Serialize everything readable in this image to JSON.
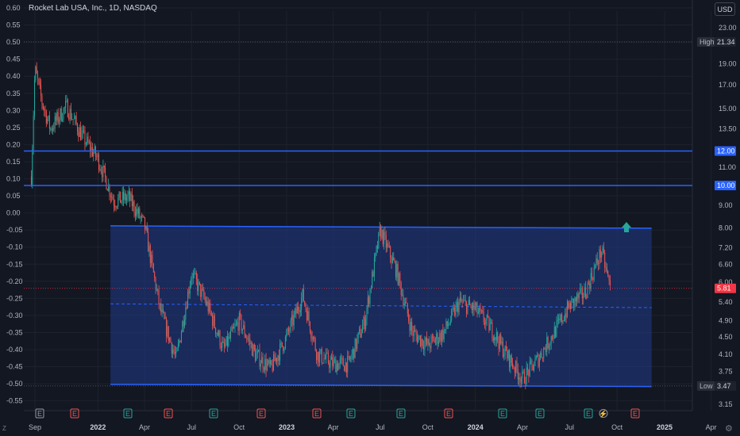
{
  "header": {
    "title": "Rocket Lab USA, Inc., 1D, NASDAQ",
    "currency": "USD"
  },
  "left_axis": {
    "ticks": [
      "0.60",
      "0.55",
      "0.50",
      "0.45",
      "0.40",
      "0.35",
      "0.30",
      "0.25",
      "0.20",
      "0.15",
      "0.10",
      "0.05",
      "0.00",
      "-0.05",
      "-0.10",
      "-0.15",
      "-0.20",
      "-0.25",
      "-0.30",
      "-0.35",
      "-0.40",
      "-0.45",
      "-0.50",
      "-0.55"
    ]
  },
  "right_axis": {
    "ticks": [
      "23.00",
      "21.34",
      "19.00",
      "17.00",
      "15.00",
      "13.50",
      "12.00",
      "11.00",
      "10.00",
      "9.00",
      "8.00",
      "7.20",
      "6.60",
      "6.00",
      "5.81",
      "5.40",
      "4.90",
      "4.50",
      "4.10",
      "3.75",
      "3.47",
      "3.15"
    ],
    "badges": {
      "high": {
        "label": "High",
        "value": "21.34"
      },
      "low": {
        "label": "Low",
        "value": "3.47"
      },
      "line_upper": "12.00",
      "line_lower": "10.00",
      "last_price": "5.81"
    }
  },
  "time_axis": {
    "labels": [
      "Sep",
      "2022",
      "Apr",
      "Jul",
      "Oct",
      "2023",
      "Apr",
      "Jul",
      "Oct",
      "2024",
      "Apr",
      "Jul",
      "Oct",
      "2025",
      "Apr"
    ]
  },
  "event_markers": [
    "E",
    "E",
    "E",
    "E",
    "E",
    "E",
    "E",
    "E",
    "E",
    "E",
    "E",
    "E",
    "E",
    "E"
  ],
  "colors": {
    "background": "#131722",
    "up": "#26a69a",
    "down": "#ef5350",
    "line": "#2962ff",
    "channel_fill": "#1f3a8a",
    "last_price": "#f23645"
  },
  "chart_data": {
    "type": "candlestick",
    "title": "Rocket Lab USA, Inc., 1D, NASDAQ",
    "scale": "log",
    "currency": "USD",
    "ylim": [
      3.15,
      23.0
    ],
    "high": 21.34,
    "low": 3.47,
    "last": 5.81,
    "horizontal_lines": [
      12.0,
      10.0
    ],
    "channel": {
      "upper": 8.0,
      "lower": 3.47,
      "midline": 5.3
    },
    "series": [
      {
        "name": "close",
        "x": [
          "2021-08-25",
          "2021-09-01",
          "2021-09-15",
          "2021-10-01",
          "2021-11-01",
          "2021-12-01",
          "2022-01-01",
          "2022-02-01",
          "2022-03-01",
          "2022-04-01",
          "2022-05-01",
          "2022-06-01",
          "2022-07-01",
          "2022-08-01",
          "2022-09-01",
          "2022-10-01",
          "2022-11-01",
          "2022-12-01",
          "2023-01-01",
          "2023-02-01",
          "2023-03-01",
          "2023-04-01",
          "2023-05-01",
          "2023-06-01",
          "2023-07-01",
          "2023-08-01",
          "2023-09-01",
          "2023-10-01",
          "2023-11-01",
          "2023-12-01",
          "2024-01-01",
          "2024-02-01",
          "2024-03-01",
          "2024-04-01",
          "2024-05-01",
          "2024-06-01",
          "2024-07-01",
          "2024-08-01",
          "2024-09-01",
          "2024-09-18"
        ],
        "values": [
          10.5,
          18.5,
          15.5,
          13.5,
          15.2,
          13.0,
          11.5,
          9.2,
          9.4,
          8.1,
          5.2,
          4.0,
          6.3,
          5.3,
          4.2,
          4.9,
          4.1,
          3.8,
          4.5,
          5.6,
          4.1,
          3.9,
          3.9,
          4.9,
          7.9,
          6.4,
          4.6,
          4.3,
          4.6,
          5.4,
          5.2,
          4.7,
          4.1,
          3.6,
          4.0,
          4.6,
          5.3,
          5.7,
          7.1,
          5.81
        ]
      }
    ]
  }
}
